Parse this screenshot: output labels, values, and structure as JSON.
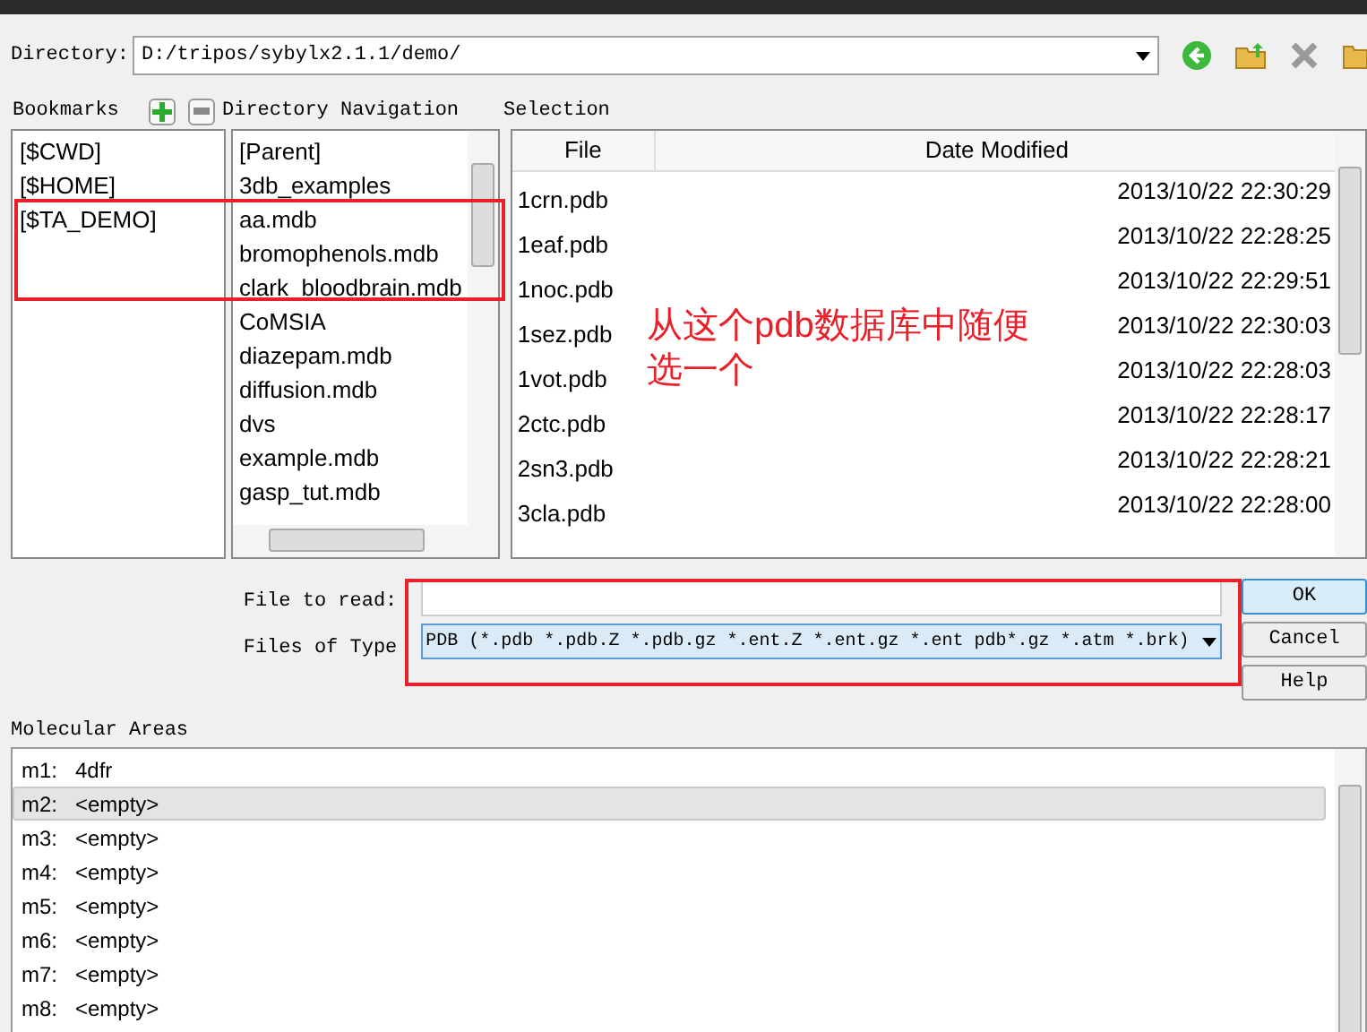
{
  "directory": {
    "label": "Directory:",
    "value": "D:/tripos/sybylx2.1.1/demo/"
  },
  "bookmarks": {
    "label": "Bookmarks",
    "items": [
      "[$CWD]",
      "[$HOME]",
      "[$TA_DEMO]"
    ]
  },
  "directory_navigation": {
    "label": "Directory Navigation",
    "items": [
      "[Parent]",
      "3db_examples",
      "aa.mdb",
      "bromophenols.mdb",
      "clark_bloodbrain.mdb",
      "CoMSIA",
      "diazepam.mdb",
      "diffusion.mdb",
      "dvs",
      "example.mdb",
      "gasp_tut.mdb"
    ]
  },
  "selection": {
    "label": "Selection",
    "columns": [
      "File",
      "Date Modified"
    ],
    "rows": [
      {
        "file": "1crn.pdb",
        "date": "2013/10/22 22:30:29"
      },
      {
        "file": "1eaf.pdb",
        "date": "2013/10/22 22:28:25"
      },
      {
        "file": "1noc.pdb",
        "date": "2013/10/22 22:29:51"
      },
      {
        "file": "1sez.pdb",
        "date": "2013/10/22 22:30:03"
      },
      {
        "file": "1vot.pdb",
        "date": "2013/10/22 22:28:03"
      },
      {
        "file": "2ctc.pdb",
        "date": "2013/10/22 22:28:17"
      },
      {
        "file": "2sn3.pdb",
        "date": "2013/10/22 22:28:21"
      },
      {
        "file": "3cla.pdb",
        "date": "2013/10/22 22:28:00"
      }
    ]
  },
  "file_to_read": {
    "label": "File to read:"
  },
  "files_of_type": {
    "label": "Files of Type",
    "value": "PDB (*.pdb *.pdb.Z *.pdb.gz *.ent.Z *.ent.gz *.ent pdb*.gz *.atm *.brk)"
  },
  "buttons": [
    "OK",
    "Cancel",
    "Help"
  ],
  "molecular_areas": {
    "label": "Molecular Areas",
    "items": [
      {
        "id": "m1:",
        "value": "4dfr",
        "selected": false
      },
      {
        "id": "m2:",
        "value": "<empty>",
        "selected": true
      },
      {
        "id": "m3:",
        "value": "<empty>",
        "selected": false
      },
      {
        "id": "m4:",
        "value": "<empty>",
        "selected": false
      },
      {
        "id": "m5:",
        "value": "<empty>",
        "selected": false
      },
      {
        "id": "m6:",
        "value": "<empty>",
        "selected": false
      },
      {
        "id": "m7:",
        "value": "<empty>",
        "selected": false
      },
      {
        "id": "m8:",
        "value": "<empty>",
        "selected": false
      }
    ]
  },
  "annotation": {
    "text": "从这个pdb数据库中随便选一个"
  }
}
